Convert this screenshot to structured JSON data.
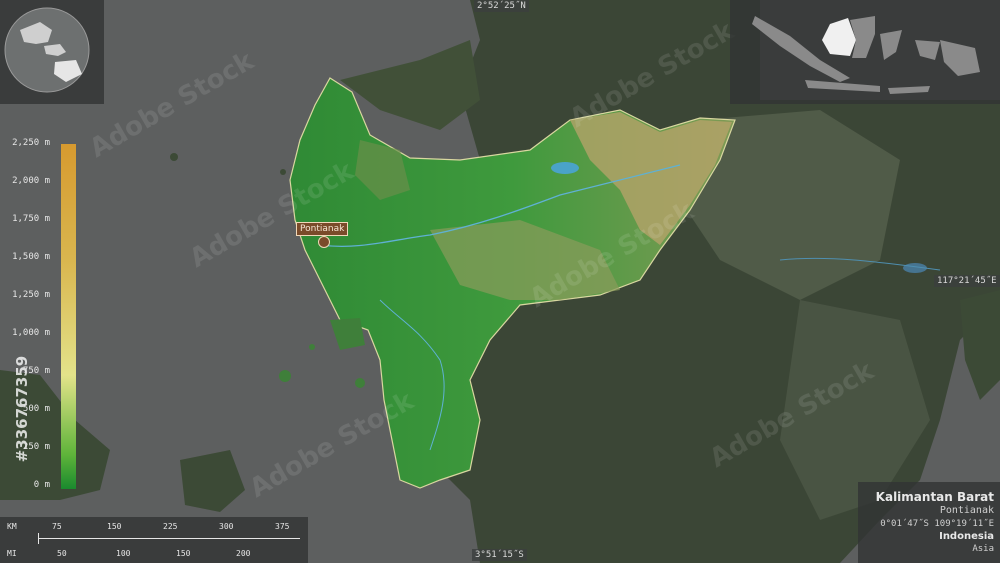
{
  "region": {
    "name": "Kalimantan Barat",
    "capital": "Pontianak",
    "capital_coords": "0°01´47˝S 109°19´11˝E",
    "country": "Indonesia",
    "continent": "Asia"
  },
  "city_label": "Pontianak",
  "edge_coords": {
    "top": "2°52´25˝N",
    "bottom": "3°51´15˝S",
    "right": "117°21´45˝E"
  },
  "elevation_legend": {
    "ticks": [
      "2,250 m",
      "2,000 m",
      "1,750 m",
      "1,500 m",
      "1,250 m",
      "1,000 m",
      "750 m",
      "500 m",
      "250 m",
      "0 m"
    ],
    "color_low": "#1a8a2e",
    "color_mid": "#e3e38a",
    "color_high": "#d79a2f"
  },
  "scale_bar": {
    "km_label": "KM",
    "km_ticks": [
      "75",
      "150",
      "225",
      "300",
      "375"
    ],
    "mi_label": "MI",
    "mi_ticks": [
      "50",
      "100",
      "150",
      "200"
    ]
  },
  "watermark": {
    "text": "Adobe Stock",
    "side_id": "#336767359"
  },
  "colors": {
    "sea": "#5d5f5f",
    "land_dark": "#3f4a3a",
    "region_green": "#3f8f3a"
  }
}
